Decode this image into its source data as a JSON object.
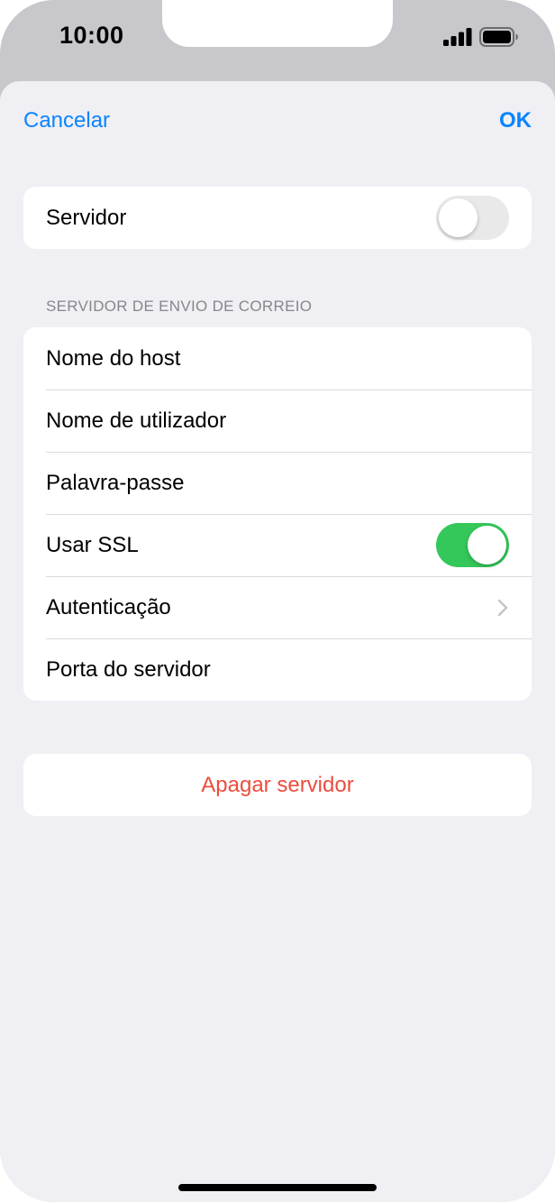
{
  "status_bar": {
    "time": "10:00",
    "icons": [
      "signal-icon",
      "battery-icon"
    ]
  },
  "nav": {
    "cancel_label": "Cancelar",
    "ok_label": "OK",
    "accent_color": "#0a84ff"
  },
  "server_toggle": {
    "label": "Servidor",
    "on": false
  },
  "outgoing_section": {
    "header": "SERVIDOR DE ENVIO DE CORREIO",
    "rows": {
      "hostname": "Nome do host",
      "username": "Nome de utilizador",
      "password": "Palavra-passe",
      "use_ssl": {
        "label": "Usar SSL",
        "on": true
      },
      "authentication": "Autenticação",
      "server_port": "Porta do servidor"
    }
  },
  "delete": {
    "label": "Apagar servidor",
    "color": "#eb4d3d"
  },
  "colors": {
    "toggle_on": "#34c759",
    "background": "#f0eff4"
  }
}
